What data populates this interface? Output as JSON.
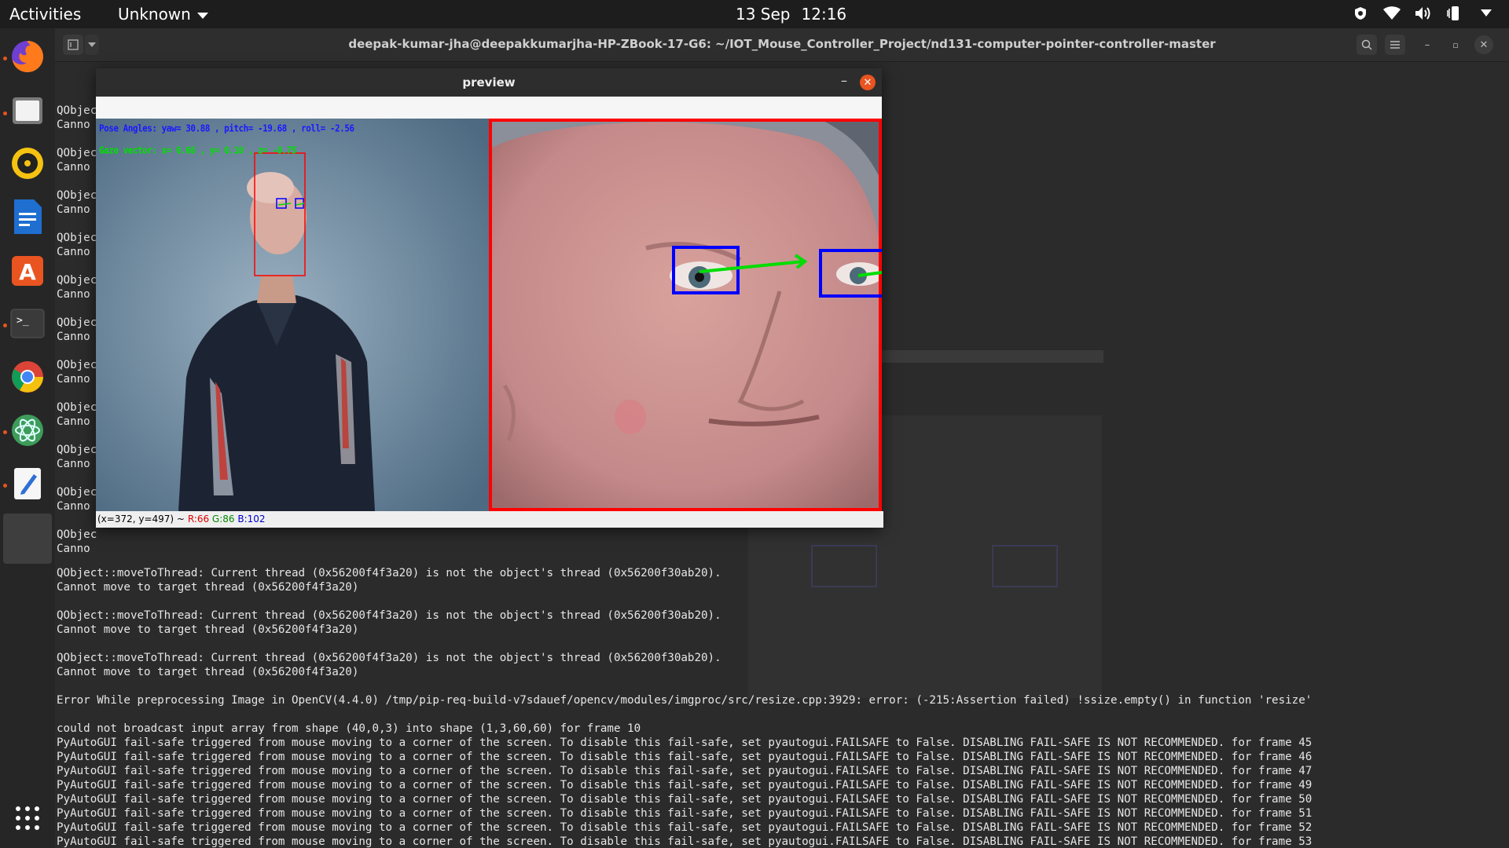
{
  "topbar": {
    "activities": "Activities",
    "app_menu": "Unknown",
    "date": "13 Sep",
    "time": "12:16",
    "tray_icons": [
      "shield-icon",
      "wifi-icon",
      "volume-icon",
      "battery-phone-icon",
      "chevron-down-icon"
    ]
  },
  "dock": {
    "items": [
      "firefox",
      "files",
      "rhythmbox",
      "writer",
      "software",
      "terminal",
      "chrome",
      "atom",
      "text-editor",
      "active-window"
    ],
    "show_apps": "grid-icon"
  },
  "terminal": {
    "title": "deepak-kumar-jha@deepakkumarjha-HP-ZBook-17-G6: ~/IOT_Mouse_Controller_Project/nd131-computer-pointer-controller-master",
    "left_fragments": [
      "QObjec",
      "Canno",
      "QObjec",
      "Canno",
      "QObjec",
      "Canno",
      "QObjec",
      "Canno",
      "QObjec",
      "Canno",
      "QObjec",
      "Canno",
      "QObjec",
      "Canno",
      "QObjec",
      "Canno",
      "QObjec",
      "Canno",
      "QObjec",
      "Canno",
      "QObjec",
      "Canno"
    ],
    "lines": [
      "QObject::moveToThread: Current thread (0x56200f4f3a20) is not the object's thread (0x56200f30ab20).",
      "Cannot move to target thread (0x56200f4f3a20)",
      "",
      "QObject::moveToThread: Current thread (0x56200f4f3a20) is not the object's thread (0x56200f30ab20).",
      "Cannot move to target thread (0x56200f4f3a20)",
      "",
      "QObject::moveToThread: Current thread (0x56200f4f3a20) is not the object's thread (0x56200f30ab20).",
      "Cannot move to target thread (0x56200f4f3a20)",
      "",
      "Error While preprocessing Image in OpenCV(4.4.0) /tmp/pip-req-build-v7sdauef/opencv/modules/imgproc/src/resize.cpp:3929: error: (-215:Assertion failed) !ssize.empty() in function 'resize'",
      "",
      "could not broadcast input array from shape (40,0,3) into shape (1,3,60,60) for frame 10",
      "PyAutoGUI fail-safe triggered from mouse moving to a corner of the screen. To disable this fail-safe, set pyautogui.FAILSAFE to False. DISABLING FAIL-SAFE IS NOT RECOMMENDED. for frame 45",
      "PyAutoGUI fail-safe triggered from mouse moving to a corner of the screen. To disable this fail-safe, set pyautogui.FAILSAFE to False. DISABLING FAIL-SAFE IS NOT RECOMMENDED. for frame 46",
      "PyAutoGUI fail-safe triggered from mouse moving to a corner of the screen. To disable this fail-safe, set pyautogui.FAILSAFE to False. DISABLING FAIL-SAFE IS NOT RECOMMENDED. for frame 47",
      "PyAutoGUI fail-safe triggered from mouse moving to a corner of the screen. To disable this fail-safe, set pyautogui.FAILSAFE to False. DISABLING FAIL-SAFE IS NOT RECOMMENDED. for frame 49",
      "PyAutoGUI fail-safe triggered from mouse moving to a corner of the screen. To disable this fail-safe, set pyautogui.FAILSAFE to False. DISABLING FAIL-SAFE IS NOT RECOMMENDED. for frame 50",
      "PyAutoGUI fail-safe triggered from mouse moving to a corner of the screen. To disable this fail-safe, set pyautogui.FAILSAFE to False. DISABLING FAIL-SAFE IS NOT RECOMMENDED. for frame 51",
      "PyAutoGUI fail-safe triggered from mouse moving to a corner of the screen. To disable this fail-safe, set pyautogui.FAILSAFE to False. DISABLING FAIL-SAFE IS NOT RECOMMENDED. for frame 52",
      "PyAutoGUI fail-safe triggered from mouse moving to a corner of the screen. To disable this fail-safe, set pyautogui.FAILSAFE to False. DISABLING FAIL-SAFE IS NOT RECOMMENDED. for frame 53"
    ]
  },
  "preview": {
    "title": "preview",
    "pose_text": "Pose Angles: yaw= 30.88 , pitch= -19.68 , roll= -2.56",
    "gaze_text": "Gaze vector: x= 0.66 , y= 0.10 , z= -0.75",
    "status_coords": "(x=372, y=497) ~",
    "status_r": "R:66",
    "status_g": "G:86",
    "status_b": "B:102",
    "colors": {
      "pose": "#1a1aff",
      "gaze": "#00e000",
      "box_red": "#ff0000",
      "box_blue": "#0000ff",
      "arrow": "#00dd00"
    }
  }
}
